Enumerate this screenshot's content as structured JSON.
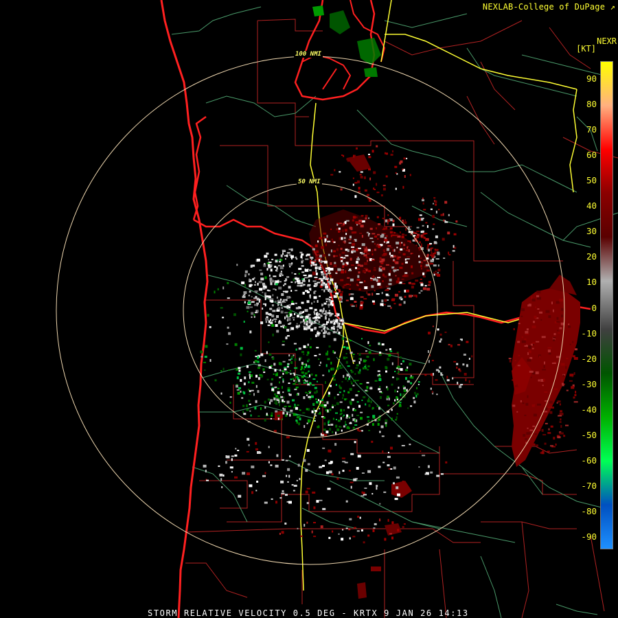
{
  "header": {
    "credit": "NEXLAB-College of DuPage",
    "product_short": "NEXR",
    "unit": "[KT]"
  },
  "footer": {
    "caption": "STORM RELATIVE VELOCITY 0.5 DEG - KRTX 9 JAN 26 14:13"
  },
  "map": {
    "range_rings": [
      {
        "range": 100,
        "label": "100 NMI"
      },
      {
        "range": 50,
        "label": "50 NMI"
      }
    ],
    "colors": {
      "background": "#000000",
      "coastline": "#ff2020",
      "state_borders": "#ff2020",
      "county_lines": "#b22222",
      "highways": "#4a9a6a",
      "interstates": "#ffff33",
      "rings": "#f0d8b0"
    }
  },
  "legend": {
    "gradient_stops": [
      "#ffff00",
      "#ffb080",
      "#ff0000",
      "#8b0000",
      "#5a0000",
      "#b0b0b0",
      "#404040",
      "#005500",
      "#00b000",
      "#00ff55",
      "#0050c0",
      "#1e90ff"
    ],
    "ticks": [
      90,
      80,
      70,
      60,
      50,
      40,
      30,
      20,
      10,
      0,
      -10,
      -20,
      -30,
      -40,
      -50,
      -60,
      -70,
      -80,
      -90
    ]
  }
}
